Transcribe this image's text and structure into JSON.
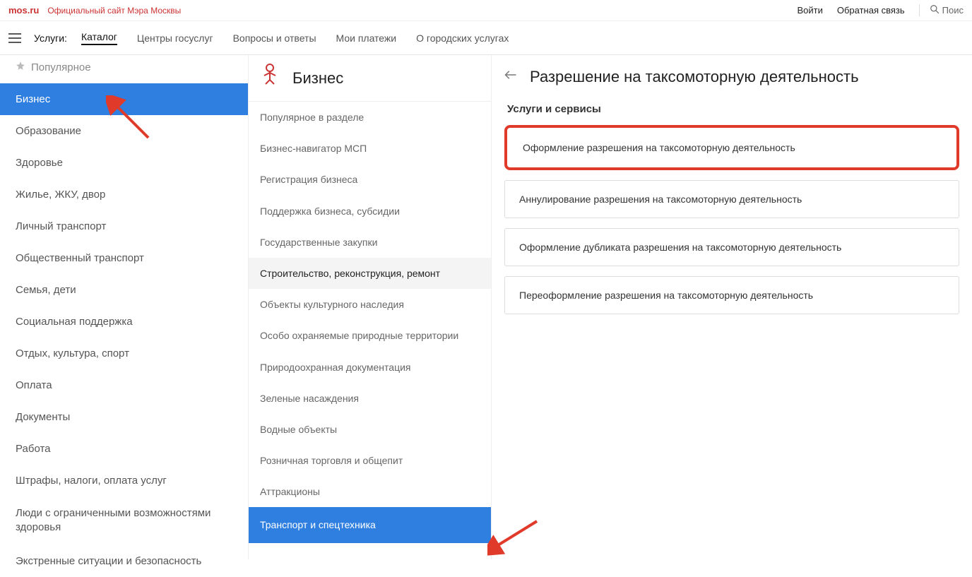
{
  "top": {
    "brand": "mos.ru",
    "brand_sub": "Официальный сайт Мэра Москвы",
    "login": "Войти",
    "feedback": "Обратная связь",
    "search_placeholder": "Поис"
  },
  "nav": {
    "label": "Услуги:",
    "items": [
      "Каталог",
      "Центры госуслуг",
      "Вопросы и ответы",
      "Мои платежи",
      "О городских услугах"
    ]
  },
  "left": {
    "popular": "Популярное",
    "items": [
      "Бизнес",
      "Образование",
      "Здоровье",
      "Жилье, ЖКУ, двор",
      "Личный транспорт",
      "Общественный транспорт",
      "Семья, дети",
      "Социальная поддержка",
      "Отдых, культура, спорт",
      "Оплата",
      "Документы",
      "Работа",
      "Штрафы, налоги, оплата услуг",
      "Люди с ограниченными возможностями здоровья",
      "Экстренные ситуации и безопасность"
    ]
  },
  "mid": {
    "title": "Бизнес",
    "items": [
      "Популярное в разделе",
      "Бизнес-навигатор МСП",
      "Регистрация бизнеса",
      "Поддержка бизнеса, субсидии",
      "Государственные закупки",
      "Строительство, реконструкция, ремонт",
      "Объекты культурного наследия",
      "Особо охраняемые природные территории",
      "Природоохранная документация",
      "Зеленые насаждения",
      "Водные объекты",
      "Розничная торговля и общепит",
      "Аттракционы",
      "Транспорт и спецтехника"
    ]
  },
  "right": {
    "title": "Разрешение на таксомоторную деятельность",
    "subtitle": "Услуги и сервисы",
    "cards": [
      "Оформление разрешения на таксомоторную деятельность",
      "Аннулирование разрешения на таксомоторную деятельность",
      "Оформление дубликата разрешения на таксомоторную деятельность",
      "Переоформление разрешения на таксомоторную деятельность"
    ]
  }
}
